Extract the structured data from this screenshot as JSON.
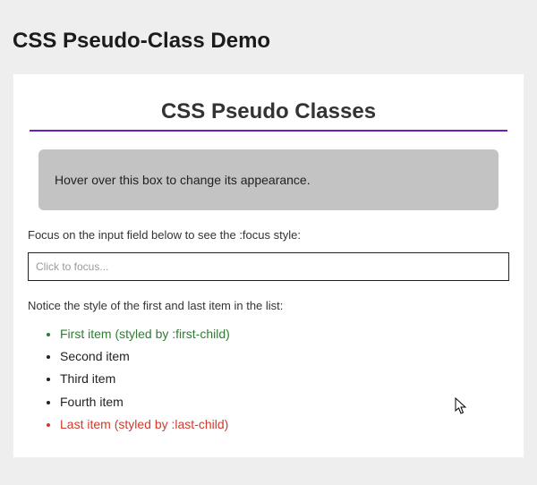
{
  "page": {
    "title": "CSS Pseudo-Class Demo"
  },
  "panel": {
    "heading": "CSS Pseudo Classes",
    "hover_box_text": "Hover over this box to change its appearance.",
    "focus_instruction": "Focus on the input field below to see the :focus style:",
    "input_placeholder": "Click to focus...",
    "list_instruction": "Notice the style of the first and last item in the list:",
    "list_items": {
      "0": "First item (styled by :first-child)",
      "1": "Second item",
      "2": "Third item",
      "3": "Fourth item",
      "4": "Last item (styled by :last-child)"
    }
  },
  "colors": {
    "accent_underline": "#6a1fbf",
    "first_child": "#2e7d32",
    "last_child": "#d23a2e",
    "hover_box_bg": "#c3c3c3"
  }
}
